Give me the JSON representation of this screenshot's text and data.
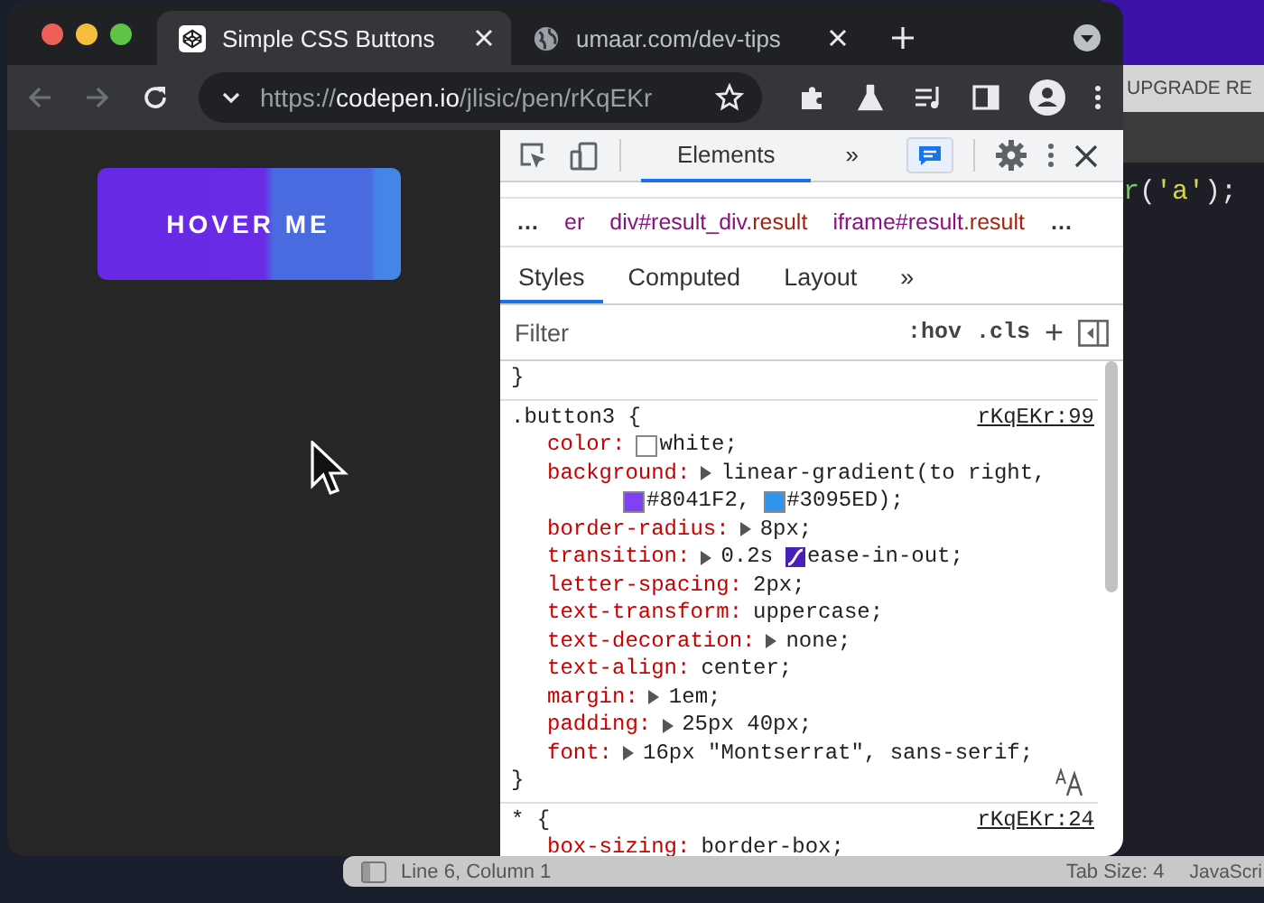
{
  "editor_window": {
    "tab": "UPGRADE RE",
    "code": [
      {
        "text": "r",
        "kind": "fn"
      },
      {
        "text": "(",
        "kind": "punct"
      },
      {
        "text": "'a'",
        "kind": "string"
      },
      {
        "text": ");",
        "kind": "punct"
      }
    ],
    "status_bar": {
      "position": "Line 6, Column 1",
      "tab_size": "Tab Size: 4",
      "language": "JavaScri"
    }
  },
  "browser": {
    "tabs": [
      {
        "title": "Simple CSS Buttons",
        "selected": true
      },
      {
        "title": "umaar.com/dev-tips",
        "selected": false
      }
    ],
    "address": {
      "scheme": "https://",
      "host": "codepen.io",
      "path": "/jlisic/pen/rKqEKr"
    },
    "page": {
      "button": "HOVER ME"
    },
    "devtools": {
      "tabs": [
        {
          "label": "Elements",
          "selected": true
        },
        {
          "label": "»",
          "selected": false
        }
      ],
      "breadcrumbs": [
        {
          "kind": "more",
          "text": "…"
        },
        {
          "kind": "node",
          "tag": "er"
        },
        {
          "kind": "node",
          "tag": "div#result_div",
          "cls": ".result"
        },
        {
          "kind": "node",
          "tag": "iframe#result",
          "cls": ".result"
        },
        {
          "kind": "more",
          "text": "…"
        }
      ],
      "subtabs": [
        {
          "label": "Styles",
          "selected": true
        },
        {
          "label": "Computed",
          "selected": false
        },
        {
          "label": "Layout",
          "selected": false
        },
        {
          "label": "»",
          "selected": false
        }
      ],
      "filter": {
        "placeholder": "Filter",
        "hov": ":hov",
        "cls": ".cls",
        "plus": "+"
      },
      "rules": [
        {
          "close": "}"
        },
        {
          "selector": ".button3 {",
          "source": "rKqEKr:99",
          "close": "}",
          "declarations": [
            {
              "name": "color:",
              "expandable": false,
              "lines": [
                [
                  {
                    "kind": "color",
                    "color": "#ffffff",
                    "text": "white;"
                  }
                ]
              ]
            },
            {
              "name": "background:",
              "expandable": true,
              "lines": [
                [
                  {
                    "kind": "text",
                    "text": "linear-gradient(to right,"
                  }
                ],
                [
                  {
                    "kind": "color",
                    "color": "#8041f2",
                    "text": "#8041F2,"
                  },
                  {
                    "kind": "color",
                    "color": "#3095ed",
                    "text": "#3095ED);"
                  }
                ]
              ]
            },
            {
              "name": "border-radius:",
              "expandable": true,
              "lines": [
                [
                  {
                    "kind": "text",
                    "text": "8px;"
                  }
                ]
              ]
            },
            {
              "name": "transition:",
              "expandable": true,
              "lines": [
                [
                  {
                    "kind": "text",
                    "text": "0.2s"
                  },
                  {
                    "kind": "easing",
                    "text": "ease-in-out;"
                  }
                ]
              ]
            },
            {
              "name": "letter-spacing:",
              "expandable": false,
              "lines": [
                [
                  {
                    "kind": "text",
                    "text": "2px;"
                  }
                ]
              ]
            },
            {
              "name": "text-transform:",
              "expandable": false,
              "lines": [
                [
                  {
                    "kind": "text",
                    "text": "uppercase;"
                  }
                ]
              ]
            },
            {
              "name": "text-decoration:",
              "expandable": true,
              "lines": [
                [
                  {
                    "kind": "text",
                    "text": "none;"
                  }
                ]
              ]
            },
            {
              "name": "text-align:",
              "expandable": false,
              "lines": [
                [
                  {
                    "kind": "text",
                    "text": "center;"
                  }
                ]
              ]
            },
            {
              "name": "margin:",
              "expandable": true,
              "lines": [
                [
                  {
                    "kind": "text",
                    "text": "1em;"
                  }
                ]
              ]
            },
            {
              "name": "padding:",
              "expandable": true,
              "lines": [
                [
                  {
                    "kind": "text",
                    "text": "25px 40px;"
                  }
                ]
              ]
            },
            {
              "name": "font:",
              "expandable": true,
              "lines": [
                [
                  {
                    "kind": "text",
                    "text": "16px \"Montserrat\", sans-serif;"
                  }
                ]
              ]
            }
          ]
        },
        {
          "selector": "* {",
          "source": "rKqEKr:24",
          "declarations": [
            {
              "name": "box-sizing:",
              "expandable": false,
              "lines": [
                [
                  {
                    "kind": "text",
                    "text": "border-box;"
                  }
                ]
              ]
            }
          ]
        }
      ]
    }
  }
}
